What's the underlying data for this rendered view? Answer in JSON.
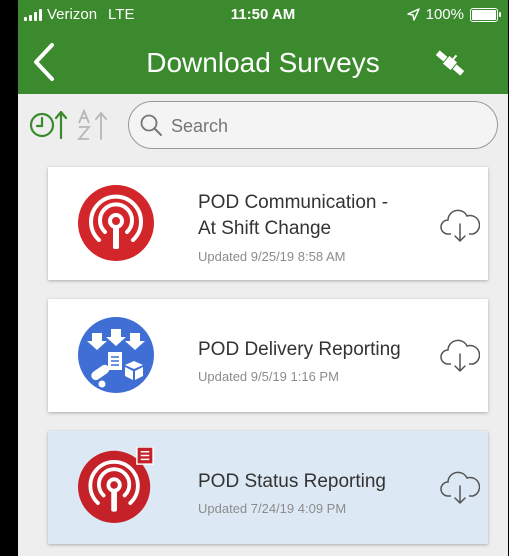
{
  "status_bar": {
    "carrier": "Verizon",
    "network": "LTE",
    "time": "11:50 AM",
    "battery": "100%"
  },
  "nav": {
    "title": "Download Surveys",
    "back_icon": "chevron-left-icon",
    "action_icon": "satellite-icon"
  },
  "toolbar": {
    "sort_by_date_icon": "clock-sort-icon",
    "sort_by_name_icon": "az-sort-icon",
    "search": {
      "placeholder": "Search",
      "value": ""
    }
  },
  "surveys": [
    {
      "title_line1": "POD Communication -",
      "title_line2": "At Shift Change",
      "updated": "Updated 9/25/19 8:58 AM",
      "icon": "broadcast-tower-icon",
      "color": "#d3262b",
      "selected": false
    },
    {
      "title_line1": "POD Delivery Reporting",
      "updated": "Updated 9/5/19 1:16 PM",
      "icon": "delivery-distribution-icon",
      "color": "#3f6fd4",
      "selected": false
    },
    {
      "title_line1": "POD Status Reporting",
      "updated": "Updated 7/24/19 4:09 PM",
      "icon": "broadcast-tower-form-icon",
      "color": "#c42228",
      "selected": true
    }
  ],
  "colors": {
    "header": "#3b8a2d",
    "selected_row": "#dce9f4",
    "accent_icon": "#3b8a2d"
  }
}
